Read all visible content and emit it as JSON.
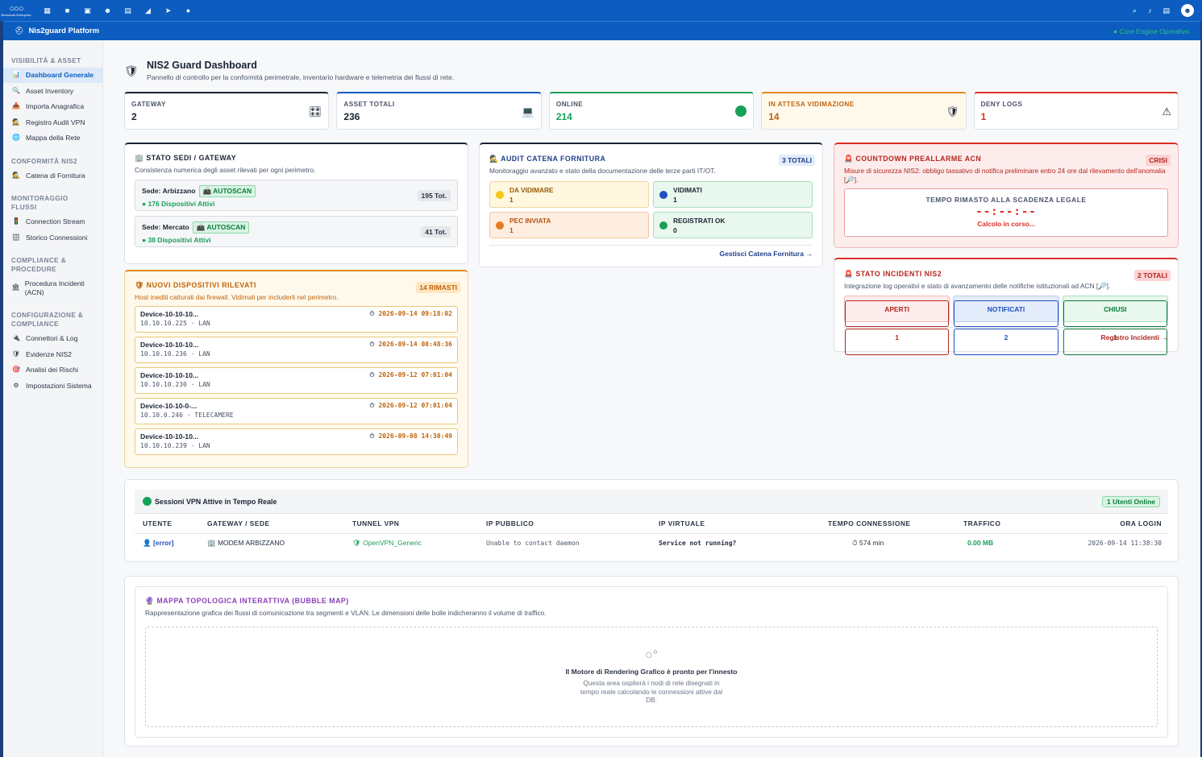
{
  "topbar": {
    "brand_name": "Nextcloud Enterprise",
    "nav_icons": [
      "dashboard-icon",
      "files-icon",
      "photos-icon",
      "contacts-icon",
      "calendar-icon",
      "deck-icon",
      "send-icon",
      "palette-icon"
    ],
    "right_icons": [
      "search-icon",
      "bell-icon",
      "contacts-menu-icon",
      "user-avatar"
    ]
  },
  "appbar": {
    "title": "Nis2guard Platform",
    "status": "● Core Engine Operativo",
    "status_color": "#27c96a"
  },
  "sidebar": {
    "sections": [
      {
        "label": "VISIBILITÀ & ASSET",
        "items": [
          {
            "label": "Dashboard Generale",
            "icon": "chart-icon",
            "active": true
          },
          {
            "label": "Asset Inventory",
            "icon": "search-icon"
          },
          {
            "label": "Importa Anagrafica",
            "icon": "import-icon"
          },
          {
            "label": "Registro Audit VPN",
            "icon": "detective-icon"
          },
          {
            "label": "Mappa della Rete",
            "icon": "globe-icon"
          }
        ]
      },
      {
        "label": "CONFORMITÀ NIS2",
        "items": [
          {
            "label": "Catena di Fornitura",
            "icon": "detective-icon"
          }
        ]
      },
      {
        "label": "MONITORAGGIO FLUSSI",
        "items": [
          {
            "label": "Connection Stream",
            "icon": "traffic-light-icon"
          },
          {
            "label": "Storico Connessioni",
            "icon": "archive-icon"
          }
        ]
      },
      {
        "label": "COMPLIANCE & PROCEDURE",
        "items": [
          {
            "label": "Procedura Incidenti (ACN)",
            "icon": "bank-icon"
          }
        ]
      },
      {
        "label": "CONFIGURAZIONE & COMPLIANCE",
        "items": [
          {
            "label": "Connettori & Log",
            "icon": "plug-icon"
          },
          {
            "label": "Evidenze NIS2",
            "icon": "shield-icon"
          },
          {
            "label": "Analisi dei Rischi",
            "icon": "target-icon"
          },
          {
            "label": "Impostazioni Sistema",
            "icon": "gear-icon"
          }
        ]
      }
    ]
  },
  "header": {
    "title": "NIS2 Guard Dashboard",
    "subtitle": "Pannello di controllo per la conformità perimetrale, inventario hardware e telemetria dei flussi di rete."
  },
  "kpis": [
    {
      "label": "GATEWAY",
      "value": "2",
      "icon": "gateway-icon"
    },
    {
      "label": "ASSET TOTALI",
      "value": "236",
      "icon": "laptop-icon"
    },
    {
      "label": "ONLINE",
      "value": "214",
      "icon": "green-dot-icon",
      "color": "#18a058"
    },
    {
      "label": "IN ATTESA VIDIMAZIONE",
      "value": "14",
      "icon": "shield-icon",
      "color": "#c0640c"
    },
    {
      "label": "DENY LOGS",
      "value": "1",
      "icon": "warning-icon",
      "color": "#d93025"
    }
  ],
  "sedi": {
    "title": "STATO SEDI / GATEWAY",
    "subtitle": "Consistenza numerica degli asset rilevati per ogni perimetro.",
    "items": [
      {
        "name": "Sede: Arbizzano",
        "tag": "AUTOSCAN",
        "active": "● 176 Dispositivi Attivi",
        "total": "195 Tot."
      },
      {
        "name": "Sede: Mercato",
        "tag": "AUTOSCAN",
        "active": "● 38 Dispositivi Attivi",
        "total": "41 Tot."
      }
    ]
  },
  "nuovi": {
    "title": "NUOVI DISPOSITIVI RILEVATI",
    "badge": "14 RIMASTI",
    "subtitle": "Host inediti catturati dai firewall. Vidimali per includerli nel perimetro.",
    "items": [
      {
        "name": "Device-10-10-10...",
        "ip": "10.10.10.225 · LAN",
        "ts": "2026-09-14 09:18:02"
      },
      {
        "name": "Device-10-10-10...",
        "ip": "10.10.10.236 · LAN",
        "ts": "2026-09-14 08:48:36"
      },
      {
        "name": "Device-10-10-10...",
        "ip": "10.10.10.230 · LAN",
        "ts": "2026-09-12 07:01:04"
      },
      {
        "name": "Device-10-10-0-...",
        "ip": "10.10.0.246 · TELECAMERE",
        "ts": "2026-09-12 07:01:04"
      },
      {
        "name": "Device-10-10-10...",
        "ip": "10.10.10.239 · LAN",
        "ts": "2026-09-08 14:30:49"
      }
    ]
  },
  "audit": {
    "title": "AUDIT CATENA FORNITURA",
    "badge": "3 TOTALI",
    "subtitle": "Monitoraggio avanzato e stato della documentazione delle terze parti IT/OT.",
    "cells": [
      {
        "label": "DA VIDIMARE",
        "value": "1"
      },
      {
        "label": "VIDIMATI",
        "value": "1"
      },
      {
        "label": "PEC INVIATA",
        "value": "1"
      },
      {
        "label": "REGISTRATI OK",
        "value": "0"
      }
    ],
    "link": "Gestisci Catena Fornitura →"
  },
  "countdown": {
    "title": "COUNTDOWN PREALLARME ACN",
    "badge": "CRISI",
    "subtitle": "Misure di sicurezza NIS2: obbligo tassativo di notifica preliminare entro 24 ore dal rilevamento dell'anomalia [🔎].",
    "box_label": "TEMPO RIMASTO ALLA SCADENZA LEGALE",
    "time": "--:--:--",
    "status": "Calcolo in corso..."
  },
  "incidenti": {
    "title": "STATO INCIDENTI NIS2",
    "badge": "2 TOTALI",
    "subtitle": "Integrazione log operativi e stato di avanzamento delle notifiche istituzionali ad ACN [🔎].",
    "cells": [
      {
        "label": "APERTI",
        "value": "1"
      },
      {
        "label": "NOTIFICATI",
        "value": "2"
      },
      {
        "label": "CHIUSI",
        "value": "1"
      }
    ],
    "link": "Registro Incidenti →"
  },
  "vpn": {
    "title": "Sessioni VPN Attive in Tempo Reale",
    "badge": "1 Utenti Online",
    "columns": [
      "UTENTE",
      "GATEWAY / SEDE",
      "TUNNEL VPN",
      "IP PUBBLICO",
      "IP VIRTUALE",
      "TEMPO CONNESSIONE",
      "TRAFFICO",
      "ORA LOGIN"
    ],
    "rows": [
      {
        "user": "[error]",
        "gateway": "MODEM ARBIZZANO",
        "tunnel": "OpenVPN_Generic",
        "ip_pub": "Unable to contact daemon",
        "ip_virt": "Service not running?",
        "time": "574 min",
        "traffic": "0.00 MB",
        "login": "2026-09-14 11:38:30"
      }
    ]
  },
  "map": {
    "title": "MAPPA TOPOLOGICA INTERATTIVA (BUBBLE MAP)",
    "subtitle": "Rappresentazione grafica dei flussi di comunicazione tra segmenti e VLAN. Le dimensioni delle bolle indicheranno il volume di traffico.",
    "ready": "Il Motore di Rendering Grafico è pronto per l'innesto",
    "description": "Questa area ospiterà i nodi di rete disegnati in tempo reale calcolando le connessioni attive dal DB."
  }
}
